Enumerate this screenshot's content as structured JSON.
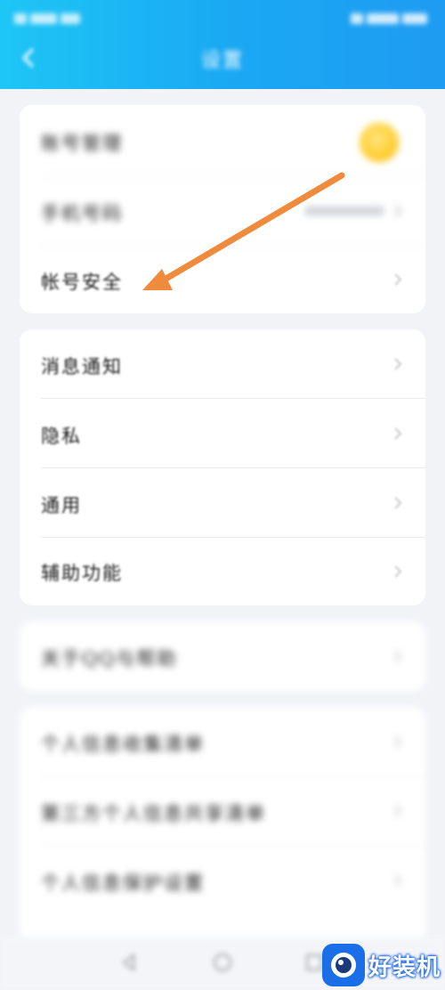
{
  "status_bar": {
    "left_text": "",
    "right_text": ""
  },
  "header": {
    "title": "设置",
    "back_icon": "chevron-left-icon"
  },
  "group1": {
    "items": [
      {
        "label": "账号管理",
        "trailing": "avatar"
      },
      {
        "label": "手机号码",
        "trailing": "masked-number"
      },
      {
        "label": "帐号安全",
        "trailing": "chevron-right-icon"
      }
    ]
  },
  "group2": {
    "items": [
      {
        "label": "消息通知"
      },
      {
        "label": "隐私"
      },
      {
        "label": "通用"
      },
      {
        "label": "辅助功能"
      }
    ]
  },
  "group3": {
    "items": [
      {
        "label": "关于QQ与帮助"
      }
    ]
  },
  "group4": {
    "items": [
      {
        "label": "个人信息收集清单"
      },
      {
        "label": "第三方个人信息共享清单"
      },
      {
        "label": "个人信息保护设置"
      }
    ]
  },
  "annotation": {
    "type": "arrow",
    "color": "#f08a3c",
    "points_to": "帐号安全"
  },
  "bottom_nav": {
    "icons": [
      "back-triangle-icon",
      "home-circle-icon",
      "recents-square-icon"
    ]
  },
  "watermark": {
    "text": "好装机",
    "logo": "eye-logo-icon",
    "logo_color": "#1a6fe8"
  },
  "colors": {
    "header_start": "#1ec6f5",
    "header_end": "#1e9bf2",
    "background": "#f2f3f7",
    "card": "#ffffff"
  }
}
